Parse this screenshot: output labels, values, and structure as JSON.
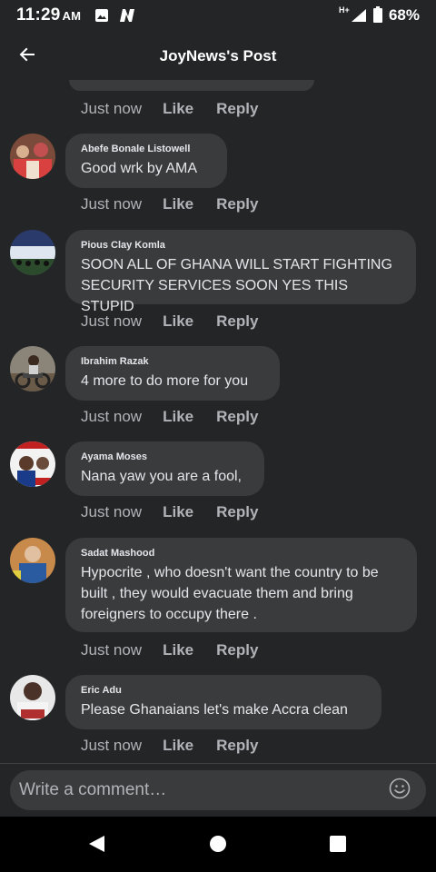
{
  "status_bar": {
    "time": "11:29",
    "ampm": "AM",
    "network": "H+",
    "battery": "68%"
  },
  "header": {
    "title": "JoyNews's Post"
  },
  "first_actions": {
    "time": "Just now",
    "like": "Like",
    "reply": "Reply"
  },
  "comments": [
    {
      "author": "Abefe Bonale Listowell",
      "text": "Good wrk by AMA",
      "time": "Just now",
      "like": "Like",
      "reply": "Reply"
    },
    {
      "author": "Pious Clay Komla",
      "text": "SOON ALL OF GHANA WILL START FIGHTING SECURITY SERVICES SOON YES THIS STUPID",
      "time": "Just now",
      "like": "Like",
      "reply": "Reply"
    },
    {
      "author": "Ibrahim Razak",
      "text": "4 more to do more for you",
      "time": "Just now",
      "like": "Like",
      "reply": "Reply"
    },
    {
      "author": "Ayama Moses",
      "text": "Nana yaw you are a fool,",
      "time": "Just now",
      "like": "Like",
      "reply": "Reply"
    },
    {
      "author": "Sadat Mashood",
      "text": "Hypocrite , who doesn't want the country to be built , they would evacuate them and bring foreigners to occupy there .",
      "time": "Just now",
      "like": "Like",
      "reply": "Reply"
    },
    {
      "author": "Eric Adu",
      "text": "Please Ghanaians let's make Accra clean",
      "time": "Just now",
      "like": "Like",
      "reply": "Reply"
    }
  ],
  "composer": {
    "placeholder": "Write a comment…"
  },
  "colors": {
    "background": "#242526",
    "bubble": "#3a3b3c",
    "text": "#e4e6eb",
    "muted": "#b0b3b8"
  },
  "icons": {
    "back": "back-arrow-icon",
    "emoji": "emoji-icon",
    "nav_back": "nav-back-icon",
    "nav_home": "nav-home-icon",
    "nav_recents": "nav-recents-icon"
  }
}
